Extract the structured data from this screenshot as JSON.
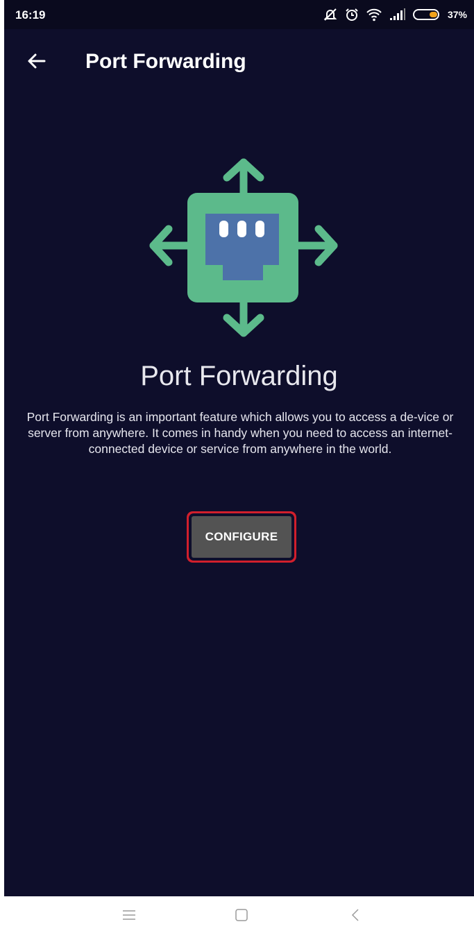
{
  "status_bar": {
    "time": "16:19",
    "battery_percent": "37%",
    "icons": [
      "mute-icon",
      "alarm-icon",
      "wifi-icon",
      "signal-icon",
      "battery-icon"
    ]
  },
  "appbar": {
    "title": "Port Forwarding",
    "back_icon": "arrow-left-icon"
  },
  "hero": {
    "icon": "port-forwarding-icon",
    "title": "Port Forwarding",
    "description": "Port Forwarding is an important feature which allows you to access a de-vice or server from anywhere. It comes in handy when you need to access an internet-connected device or service from anywhere in the world."
  },
  "actions": {
    "configure_label": "CONFIGURE"
  },
  "colors": {
    "background": "#0e0e2b",
    "icon_green": "#5cba8b",
    "icon_blue": "#4d72a9",
    "button": "#535353",
    "highlight": "#d11f2c"
  },
  "navbar": {
    "icons": [
      "menu-icon",
      "home-icon",
      "back-icon"
    ]
  }
}
